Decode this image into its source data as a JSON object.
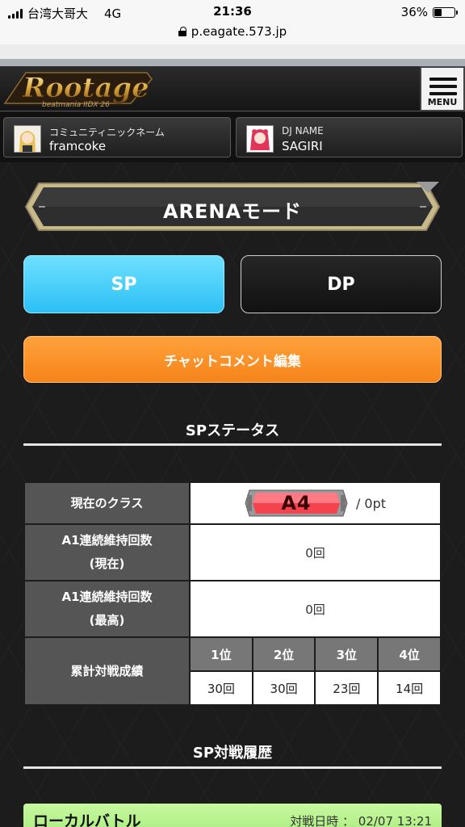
{
  "status_bar": {
    "carrier": "台湾大哥大",
    "network": "4G",
    "time": "21:36",
    "battery": "36%",
    "battery_level": 0.36
  },
  "browser": {
    "url": "p.eagate.573.jp"
  },
  "header": {
    "logo_text": "Rootage",
    "menu_label": "MENU"
  },
  "user": {
    "community_label": "コミュニティニックネーム",
    "community_value": "framcoke",
    "dj_label": "DJ NAME",
    "dj_value": "SAGIRI"
  },
  "main": {
    "title": "ARENAモード",
    "sp_label": "SP",
    "dp_label": "DP",
    "chat_label": "チャットコメント編集",
    "status_title": "SPステータス",
    "history_title": "SP対戦履歴"
  },
  "status_table": {
    "class_label": "現在のクラス",
    "class_value": "A4",
    "class_points": "/ 0pt",
    "a1_current_label_1": "A1連続維持回数",
    "a1_current_label_2": "(現在)",
    "a1_current_value": "0回",
    "a1_best_label_1": "A1連続維持回数",
    "a1_best_label_2": "(最高)",
    "a1_best_value": "0回",
    "record_label": "累計対戦成績",
    "ranks": [
      "1位",
      "2位",
      "3位",
      "4位"
    ],
    "counts": [
      "30回",
      "30回",
      "23回",
      "14回"
    ]
  },
  "battle": {
    "type": "ローカルバトル",
    "date_label": "対戦日時 ： 02/07 13:21"
  },
  "colors": {
    "sp_accent": "#2bc0f5",
    "chat_accent": "#f6841a",
    "battle_header": "#a9ec7e"
  }
}
